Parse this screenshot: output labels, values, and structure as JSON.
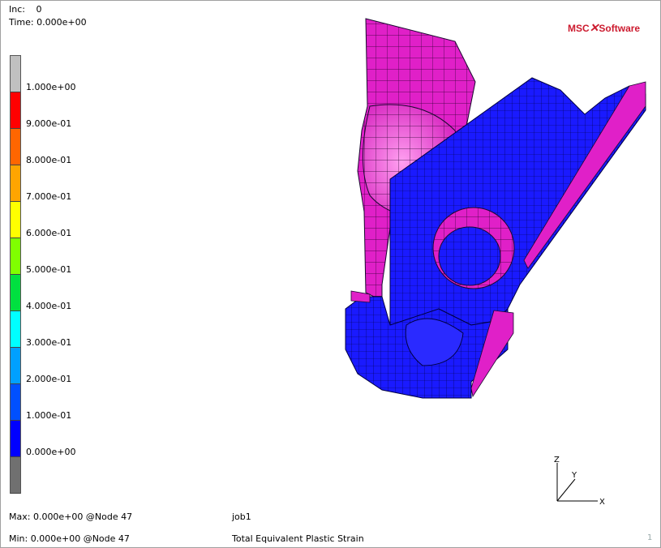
{
  "header": {
    "inc_label": "Inc:",
    "inc_value": "0",
    "time_label": "Time:",
    "time_value": "0.000e+00"
  },
  "logo": {
    "brand_a": "MSC",
    "brand_b": "Software"
  },
  "legend": {
    "colors": [
      "#c0c0c0",
      "#ff0000",
      "#ff6600",
      "#ffa500",
      "#ffff00",
      "#80ff00",
      "#00e040",
      "#00ffff",
      "#00a0ff",
      "#0050ff",
      "#0000ff",
      "#707070"
    ],
    "labels": [
      "1.000e+00",
      "9.000e-01",
      "8.000e-01",
      "7.000e-01",
      "6.000e-01",
      "5.000e-01",
      "4.000e-01",
      "3.000e-01",
      "2.000e-01",
      "1.000e-01",
      "0.000e+00"
    ]
  },
  "footer": {
    "max": "Max:  0.000e+00 @Node  47",
    "min": "Min:  0.000e+00 @Node  47",
    "job": "job1",
    "result": "Total Equivalent Plastic Strain",
    "page": "1"
  },
  "colors": {
    "mesh_magenta": "#e020c8",
    "mesh_blue": "#1a1aff",
    "edge": "#1a0a30"
  },
  "triad": {
    "x": "X",
    "y": "Y",
    "z": "Z"
  }
}
